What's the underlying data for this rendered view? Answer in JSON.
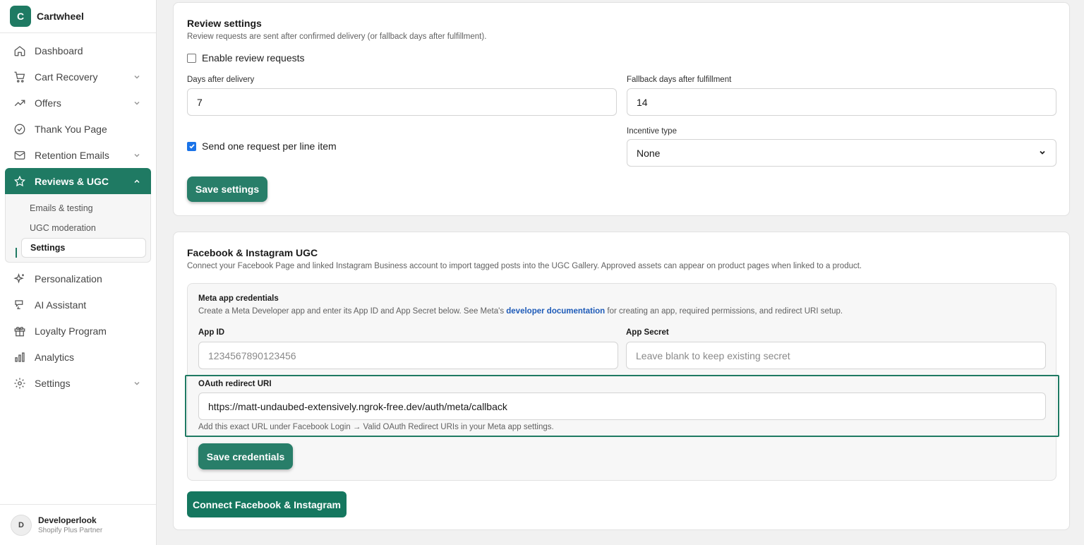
{
  "app": {
    "initial": "C",
    "name": "Cartwheel"
  },
  "sidebar": {
    "items": [
      {
        "label": "Dashboard",
        "icon": "home-icon"
      },
      {
        "label": "Cart Recovery",
        "icon": "cart-icon"
      },
      {
        "label": "Offers",
        "icon": "trend-icon"
      },
      {
        "label": "Thank You Page",
        "icon": "check-circle-icon"
      },
      {
        "label": "Retention Emails",
        "icon": "mail-icon"
      },
      {
        "label": "Reviews & UGC",
        "icon": "star-icon"
      },
      {
        "label": "Personalization",
        "icon": "sparkle-icon"
      },
      {
        "label": "AI Assistant",
        "icon": "ai-icon"
      },
      {
        "label": "Loyalty Program",
        "icon": "gift-icon"
      },
      {
        "label": "Analytics",
        "icon": "chart-icon"
      },
      {
        "label": "Settings",
        "icon": "gear-icon"
      }
    ],
    "subitems": [
      "Emails & testing",
      "UGC moderation",
      "Settings"
    ]
  },
  "user": {
    "initial": "D",
    "name": "Developerlook",
    "role": "Shopify Plus Partner"
  },
  "review": {
    "title": "Review settings",
    "description": "Review requests are sent after confirmed delivery (or fallback days after fulfillment).",
    "enable_label": "Enable review requests",
    "enable_checked": false,
    "days_label": "Days after delivery",
    "days_value": "7",
    "fallback_label": "Fallback days after fulfillment",
    "fallback_value": "14",
    "per_line_label": "Send one request per line item",
    "per_line_checked": true,
    "incentive_label": "Incentive type",
    "incentive_value": "None",
    "save_label": "Save settings"
  },
  "ugc": {
    "title": "Facebook & Instagram UGC",
    "description": "Connect your Facebook Page and linked Instagram Business account to import tagged posts into the UGC Gallery. Approved assets can appear on product pages when linked to a product.",
    "meta": {
      "title": "Meta app credentials",
      "desc_before": "Create a Meta Developer app and enter its App ID and App Secret below. See Meta's ",
      "desc_link": "developer documentation",
      "desc_after": " for creating an app, required permissions, and redirect URI setup.",
      "app_id_label": "App ID",
      "app_id_placeholder": "1234567890123456",
      "secret_label": "App Secret",
      "secret_placeholder": "Leave blank to keep existing secret",
      "redirect_label": "OAuth redirect URI",
      "redirect_value": "https://matt-undaubed-extensively.ngrok-free.dev/auth/meta/callback",
      "redirect_help": "Add this exact URL under Facebook Login → Valid OAuth Redirect URIs in your Meta app settings.",
      "save_label": "Save credentials"
    },
    "connect_label": "Connect Facebook & Instagram"
  },
  "colors": {
    "accent": "#1f7a63",
    "link": "#1e5bb8"
  }
}
